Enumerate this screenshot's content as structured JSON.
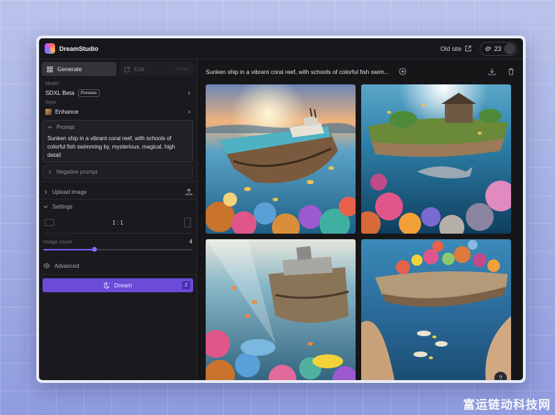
{
  "app": {
    "brand": "DreamStudio",
    "old_site": "Old site",
    "credits": "23"
  },
  "tabs": {
    "generate": "Generate",
    "edit": "Edit",
    "edit_badge": "SOON"
  },
  "model": {
    "label": "Model",
    "value": "SDXL Beta",
    "badge": "Preview"
  },
  "style": {
    "label": "Style",
    "value": "Enhance"
  },
  "prompt": {
    "label": "Prompt",
    "text": "Sunken ship in a vibrant coral reef, with schools of colorful fish swimming by, mysterious, magical, high detail"
  },
  "negative_prompt": {
    "label": "Negative prompt"
  },
  "upload": {
    "label": "Upload image"
  },
  "settings": {
    "label": "Settings",
    "aspect_ratio": "1 : 1",
    "image_count_label": "Image count",
    "image_count": "4",
    "image_count_level": 0.34,
    "advanced": "Advanced"
  },
  "dream": {
    "label": "Dream",
    "count": "2"
  },
  "main": {
    "title": "Sunken ship in a vibrant coral reef, with schools of colorful fish swim..."
  },
  "help": "?",
  "watermark": "富运链动科技网"
}
